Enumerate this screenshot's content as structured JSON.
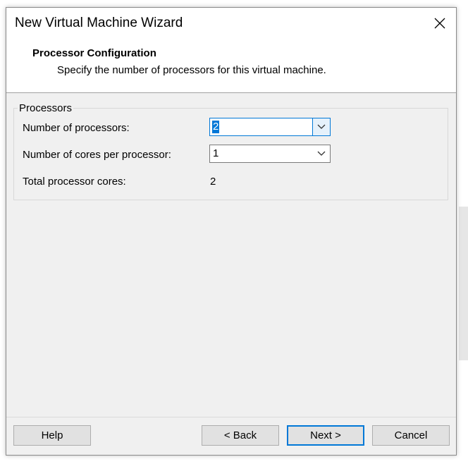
{
  "window": {
    "title": "New Virtual Machine Wizard"
  },
  "header": {
    "title": "Processor Configuration",
    "subtitle": "Specify the number of processors for this virtual machine."
  },
  "processors_group": {
    "label": "Processors",
    "num_processors_label": "Number of processors:",
    "num_processors_value": "2",
    "cores_per_processor_label": "Number of cores per processor:",
    "cores_per_processor_value": "1",
    "total_cores_label": "Total processor cores:",
    "total_cores_value": "2"
  },
  "buttons": {
    "help": "Help",
    "back": "< Back",
    "next": "Next >",
    "cancel": "Cancel"
  },
  "colors": {
    "accent": "#0078d7",
    "dialog_bg": "#f0f0f0",
    "header_bg": "#ffffff"
  }
}
